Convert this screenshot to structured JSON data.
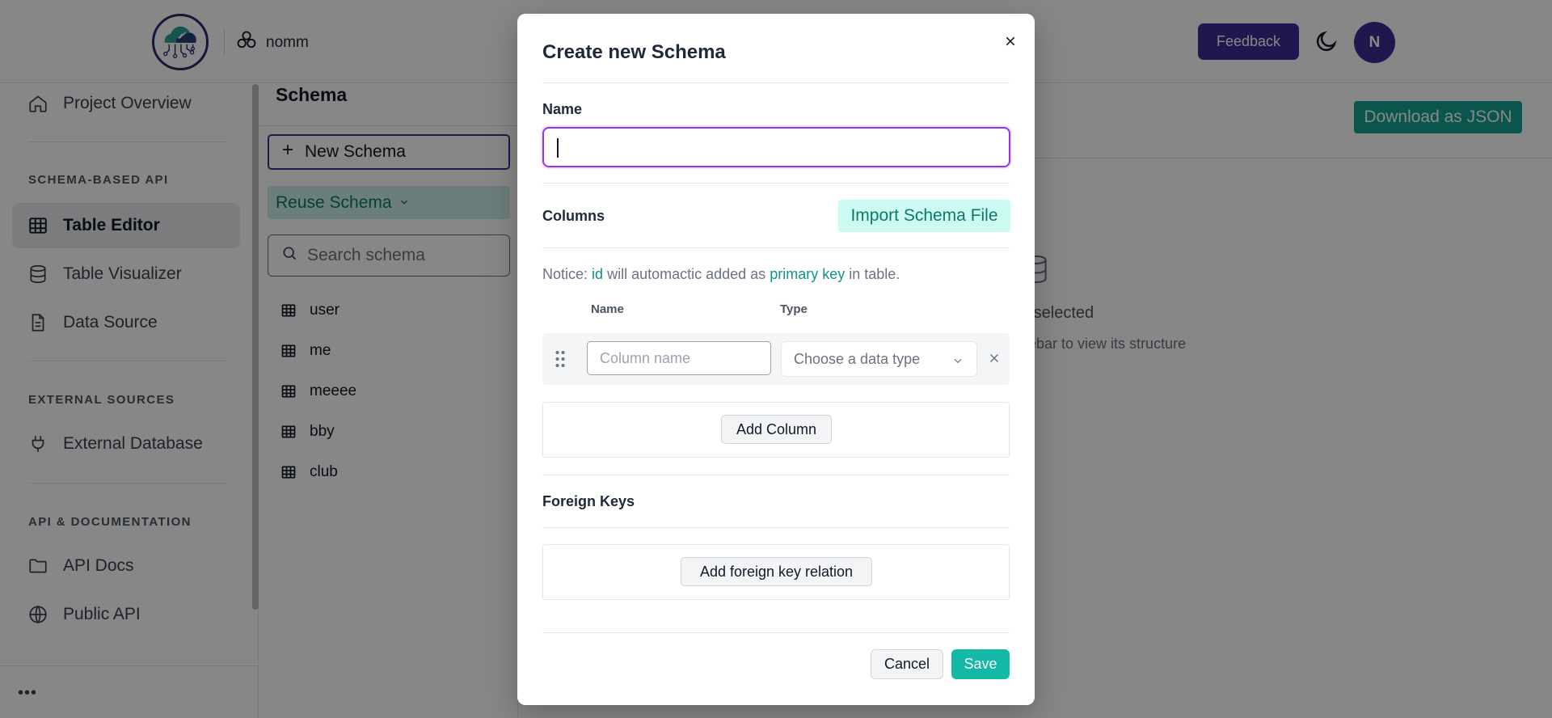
{
  "header": {
    "project_name": "nomm",
    "feedback_label": "Feedback",
    "avatar_initial": "N"
  },
  "sidebar": {
    "items": [
      {
        "label": "Project Overview",
        "icon": "home-icon"
      },
      {
        "label": "Table Editor",
        "icon": "table-icon"
      },
      {
        "label": "Table Visualizer",
        "icon": "database-icon"
      },
      {
        "label": "Data Source",
        "icon": "document-icon"
      },
      {
        "label": "External Database",
        "icon": "plug-icon"
      },
      {
        "label": "API Docs",
        "icon": "folder-icon"
      },
      {
        "label": "Public API",
        "icon": "globe-icon"
      }
    ],
    "sections": [
      "SCHEMA-BASED API",
      "EXTERNAL SOURCES",
      "API & DOCUMENTATION"
    ],
    "more_label": "•••"
  },
  "schema_panel": {
    "title": "Schema",
    "new_schema_label": "New Schema",
    "reuse_schema_label": "Reuse Schema",
    "search_placeholder": "Search schema",
    "schemas": [
      "user",
      "me",
      "meeee",
      "bby",
      "club"
    ]
  },
  "main": {
    "download_label": "Download as JSON",
    "empty_title": "a selected",
    "empty_subtitle": "debar to view its structure"
  },
  "modal": {
    "title": "Create new Schema",
    "name_label": "Name",
    "name_value": "",
    "columns_label": "Columns",
    "import_label": "Import Schema File",
    "notice_prefix": "Notice:",
    "notice_id": "id",
    "notice_mid": "will automactic added as",
    "notice_pk": "primary key",
    "notice_suffix": "in table.",
    "col_header_name": "Name",
    "col_header_type": "Type",
    "column_name_placeholder": "Column name",
    "data_type_placeholder": "Choose a data type",
    "add_column_label": "Add Column",
    "foreign_keys_label": "Foreign Keys",
    "add_fk_label": "Add foreign key relation",
    "cancel_label": "Cancel",
    "save_label": "Save"
  },
  "colors": {
    "primary": "#3b2c93",
    "accent": "#14b8a6",
    "focus": "#9333ea"
  }
}
